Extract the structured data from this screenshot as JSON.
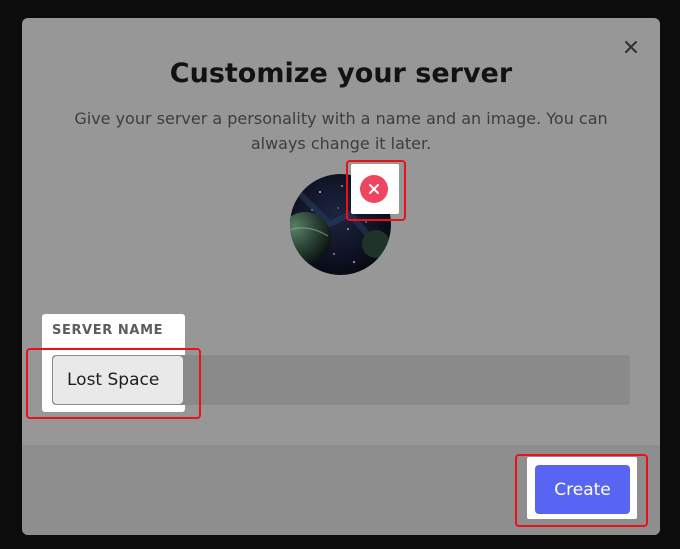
{
  "modal": {
    "title": "Customize your server",
    "subtitle": "Give your server a personality with a name and an image. You can always change it later.",
    "close_icon": "close-icon",
    "remove_icon": "remove-image-icon"
  },
  "server_name": {
    "label": "SERVER NAME",
    "value": "Lost Space"
  },
  "footer": {
    "create_label": "Create"
  },
  "colors": {
    "accent": "#5865f2",
    "remove": "#ee4561",
    "highlight": "#e8131a"
  }
}
